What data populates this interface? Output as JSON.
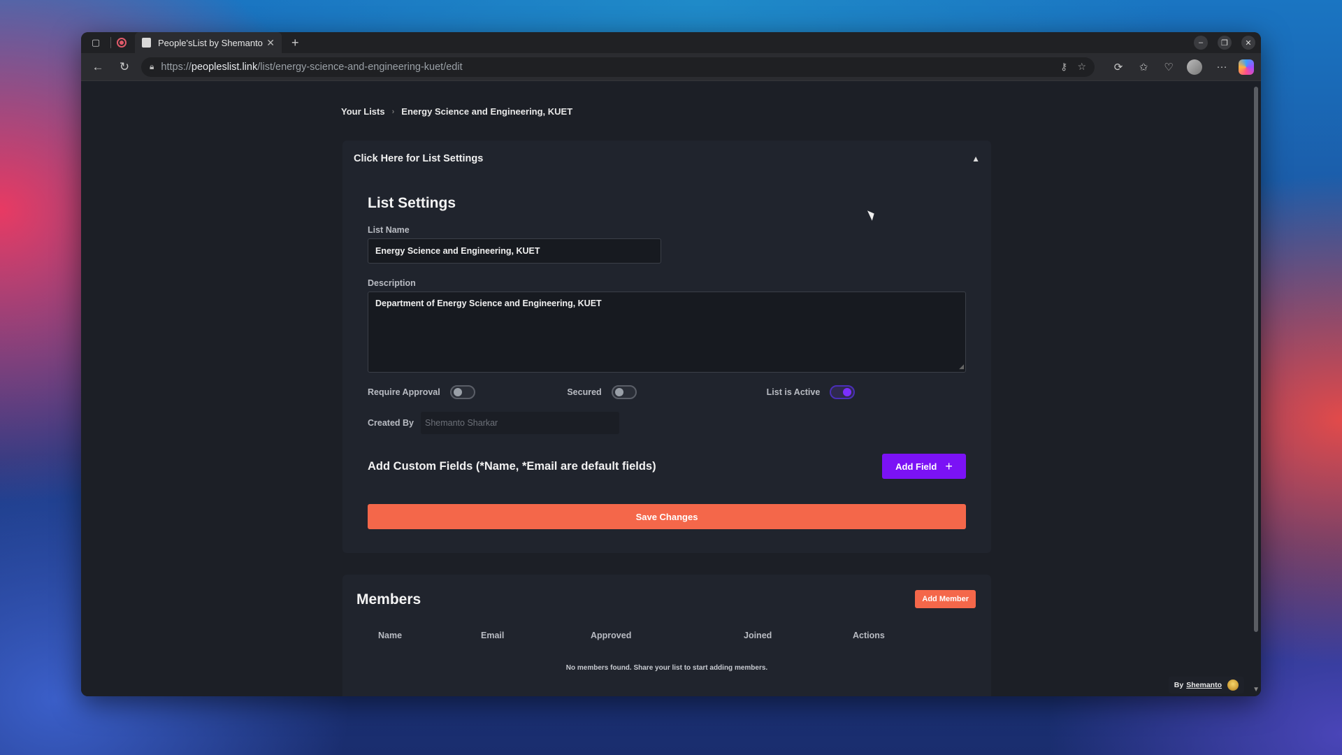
{
  "browser": {
    "tab_title": "People'sList by Shemanto",
    "url_scheme": "https://",
    "url_host": "peopleslist.link",
    "url_path": "/list/energy-science-and-engineering-kuet/edit"
  },
  "breadcrumb": {
    "root": "Your Lists",
    "current": "Energy Science and Engineering, KUET"
  },
  "settings": {
    "toggle_header": "Click Here for List Settings",
    "heading": "List Settings",
    "list_name_label": "List Name",
    "list_name_value": "Energy Science and Engineering, KUET",
    "description_label": "Description",
    "description_value": "Department of Energy Science and Engineering, KUET",
    "require_approval_label": "Require Approval",
    "require_approval_on": false,
    "secured_label": "Secured",
    "secured_on": false,
    "active_label": "List is Active",
    "active_on": true,
    "created_by_label": "Created By",
    "created_by_value": "Shemanto Sharkar",
    "custom_fields_title": "Add Custom Fields (*Name, *Email are default fields)",
    "add_field_label": "Add Field",
    "save_label": "Save Changes"
  },
  "members": {
    "title": "Members",
    "add_member_label": "Add Member",
    "columns": [
      "Name",
      "Email",
      "Approved",
      "Joined",
      "Actions"
    ],
    "empty_text": "No members found. Share your list to start adding members."
  },
  "footer": {
    "by_text": "By",
    "author": "Shemanto"
  },
  "colors": {
    "accent_purple": "#7b12f5",
    "accent_orange": "#f4674a",
    "background": "#1c1f26"
  }
}
